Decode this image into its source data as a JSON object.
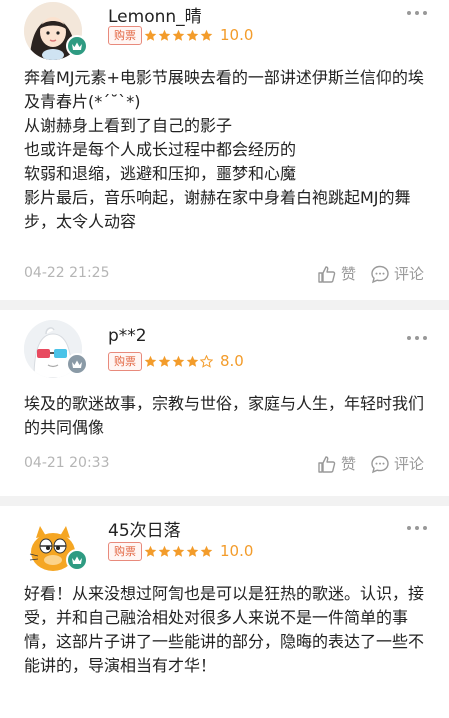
{
  "reviews": [
    {
      "username": "Lemonn_晴",
      "badge": "购票",
      "rating_stars": 5,
      "score": "10.0",
      "content": "奔着MJ元素+电影节展映去看的一部讲述伊斯兰信仰的埃及青春片(*ˊ˘ˋ*)\n从谢赫身上看到了自己的影子\n也或许是每个人成长过程中都会经历的\n软弱和退缩，逃避和压抑，噩梦和心魔\n影片最后，音乐响起，谢赫在家中身着白袍跳起MJ的舞步，太令人动容",
      "date": "04-22 21:25",
      "like_label": "赞",
      "comment_label": "评论"
    },
    {
      "username": "p**2",
      "badge": "购票",
      "rating_stars": 4,
      "score": "8.0",
      "content": "埃及的歌迷故事，宗教与世俗，家庭与人生，年轻时我们的共同偶像",
      "date": "04-21 20:33",
      "like_label": "赞",
      "comment_label": "评论"
    },
    {
      "username": "45次日落",
      "badge": "购票",
      "rating_stars": 5,
      "score": "10.0",
      "content": "好看！从来没想过阿訇也是可以是狂热的歌迷。认识，接受，并和自己融洽相处对很多人来说不是一件简单的事情，这部片子讲了一些能讲的部分，隐晦的表达了一些不能讲的，导演相当有才华！"
    }
  ],
  "colors": {
    "star": "#f39c2b",
    "star_empty": "#f39c2b",
    "badge": "#e2643f",
    "level": "#2f9b82",
    "divider": "#f2f2f2"
  },
  "icons": [
    "more-icon",
    "star-icon",
    "like-icon",
    "comment-icon",
    "level-icon"
  ]
}
